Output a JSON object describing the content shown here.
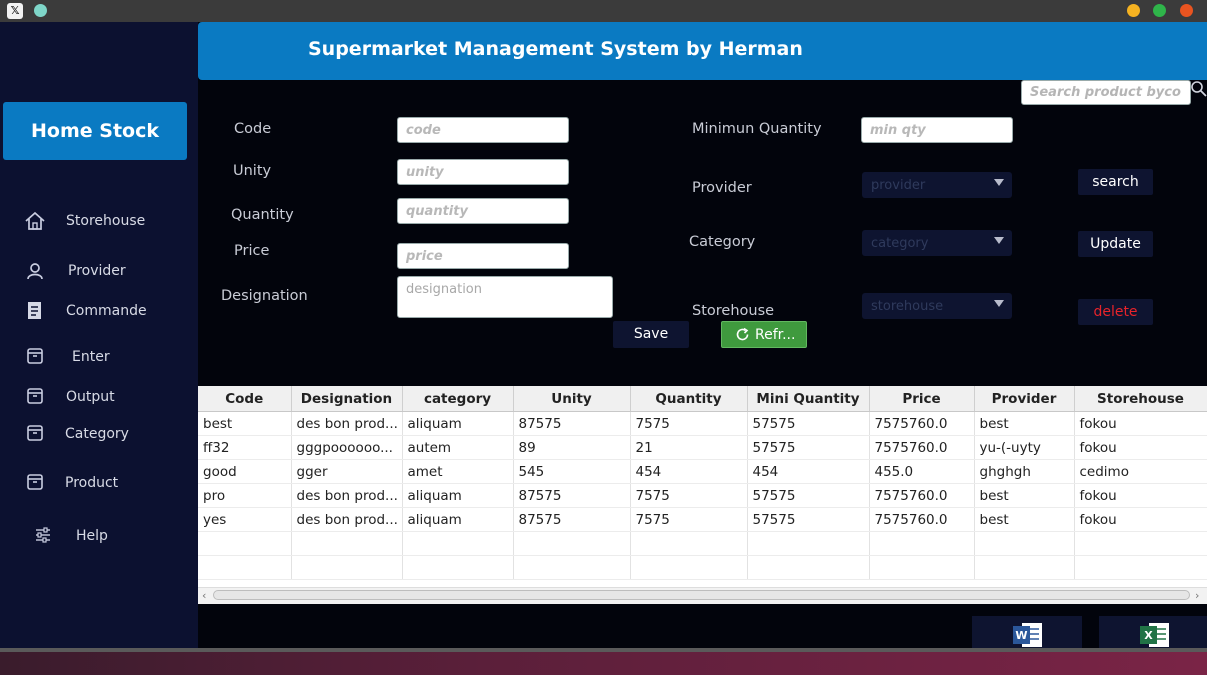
{
  "window": {
    "close_color": "#e95420",
    "minimize_color": "#f5b221",
    "maximize_color": "#2fb54a"
  },
  "sidebar": {
    "home_button": "Home Stock",
    "items": [
      {
        "label": "Storehouse",
        "icon": "home-icon"
      },
      {
        "label": "Provider",
        "icon": "user-icon"
      },
      {
        "label": "Commande",
        "icon": "document-icon"
      },
      {
        "label": "Enter",
        "icon": "box-icon"
      },
      {
        "label": "Output",
        "icon": "box-icon"
      },
      {
        "label": "Category",
        "icon": "box-icon"
      },
      {
        "label": "Product",
        "icon": "box-icon"
      },
      {
        "label": "Help",
        "icon": "sliders-icon"
      }
    ]
  },
  "header": {
    "title": "Supermarket Management System by Herman",
    "search_placeholder": "Search product byco"
  },
  "form": {
    "code_label": "Code",
    "code_placeholder": "code",
    "unity_label": "Unity",
    "unity_placeholder": "unity",
    "quantity_label": "Quantity",
    "quantity_placeholder": "quantity",
    "price_label": "Price",
    "price_placeholder": "price",
    "designation_label": "Designation",
    "designation_placeholder": "designation",
    "min_qty_label": "Minimun Quantity",
    "min_qty_placeholder": "min qty",
    "provider_label": "Provider",
    "provider_value": "provider",
    "category_label": "Category",
    "category_value": "category",
    "storehouse_label": "Storehouse",
    "storehouse_value": "storehouse"
  },
  "buttons": {
    "search": "search",
    "update": "Update",
    "delete": "delete",
    "save": "Save",
    "refresh": "Refr..."
  },
  "table": {
    "columns": [
      "Code",
      "Designation",
      "category",
      "Unity",
      "Quantity",
      "Mini Quantity",
      "Price",
      "Provider",
      "Storehouse"
    ],
    "rows": [
      [
        "best",
        "des bon prod...",
        "aliquam",
        "87575",
        "7575",
        "57575",
        "7575760.0",
        "best",
        "fokou"
      ],
      [
        "ff32",
        "gggpoooooo...",
        "autem",
        "89",
        "21",
        "57575",
        "7575760.0",
        "yu-(-uyty",
        "fokou"
      ],
      [
        "good",
        "gger",
        "amet",
        "545",
        "454",
        "454",
        "455.0",
        "ghghgh",
        "cedimo"
      ],
      [
        "pro",
        "des bon prod...",
        "aliquam",
        "87575",
        "7575",
        "57575",
        "7575760.0",
        "best",
        "fokou"
      ],
      [
        "yes",
        "des bon prod...",
        "aliquam",
        "87575",
        "7575",
        "57575",
        "7575760.0",
        "best",
        "fokou"
      ]
    ]
  },
  "export": {
    "word_icon": "word-icon",
    "excel_icon": "excel-icon"
  }
}
